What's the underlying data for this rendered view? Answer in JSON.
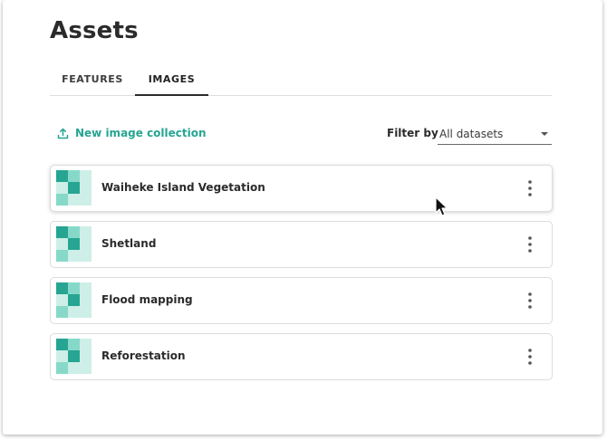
{
  "page": {
    "title": "Assets"
  },
  "tabs": [
    {
      "label": "FEATURES",
      "active": false
    },
    {
      "label": "IMAGES",
      "active": true
    }
  ],
  "toolbar": {
    "new_collection_label": "New image collection",
    "upload_icon": "upload-icon"
  },
  "filter": {
    "label": "Filter by",
    "selected": "All datasets"
  },
  "collections": [
    {
      "name": "Waiheke Island Vegetation"
    },
    {
      "name": "Shetland"
    },
    {
      "name": "Flood mapping"
    },
    {
      "name": "Reforestation"
    }
  ],
  "colors": {
    "accent": "#26a592",
    "thumb_dark": "#26a592",
    "thumb_mid": "#86d9c9",
    "thumb_light": "#cdefe8"
  }
}
